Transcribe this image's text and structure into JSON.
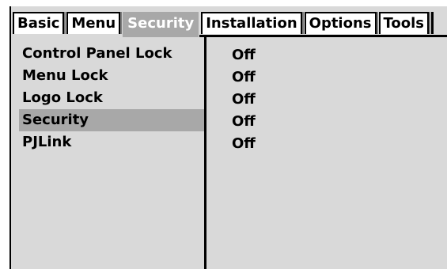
{
  "tabs": [
    {
      "label": "Basic",
      "active": false
    },
    {
      "label": "Menu",
      "active": false
    },
    {
      "label": "Security",
      "active": true
    },
    {
      "label": "Installation",
      "active": false
    },
    {
      "label": "Options",
      "active": false
    },
    {
      "label": "Tools",
      "active": false
    }
  ],
  "menu": {
    "items": [
      {
        "label": "Control Panel Lock",
        "value": "Off",
        "selected": false
      },
      {
        "label": "Menu Lock",
        "value": "Off",
        "selected": false
      },
      {
        "label": "Logo Lock",
        "value": "Off",
        "selected": false
      },
      {
        "label": "Security",
        "value": "Off",
        "selected": true
      },
      {
        "label": "PJLink",
        "value": "Off",
        "selected": false
      }
    ]
  },
  "colors": {
    "panel_background": "#d9d9d9",
    "highlight": "#a8a8a8",
    "active_tab_text": "#ffffff",
    "border": "#000000"
  }
}
